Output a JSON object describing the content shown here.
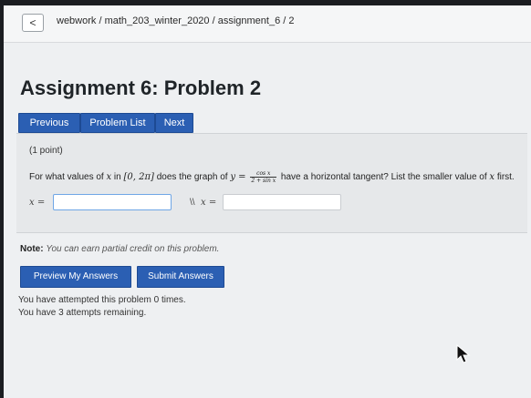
{
  "header": {
    "back_label": "<",
    "breadcrumb": "webwork / math_203_winter_2020 / assignment_6 / 2"
  },
  "page": {
    "title": "Assignment 6: Problem 2"
  },
  "nav": {
    "previous": "Previous",
    "problem_list": "Problem List",
    "next": "Next"
  },
  "problem": {
    "points": "(1 point)",
    "question_prefix": "For what values of ",
    "var_x": "x",
    "question_in": " in ",
    "interval": "[0, 2π]",
    "question_graph": " does the graph of ",
    "var_y": "y =",
    "frac_num": "cos x",
    "frac_den": "2 + sin x",
    "question_suffix": " have a horizontal tangent? List the smaller value of ",
    "question_end": " first.",
    "answer_label_1": "x =",
    "answer_value_1": "",
    "separator": "\\\\",
    "answer_label_2": "x =",
    "answer_value_2": ""
  },
  "note": {
    "label": "Note:",
    "text": "You can earn partial credit on this problem."
  },
  "actions": {
    "preview": "Preview My Answers",
    "submit": "Submit Answers"
  },
  "status": {
    "attempted": "You have attempted this problem 0 times.",
    "remaining": "You have 3 attempts remaining."
  }
}
